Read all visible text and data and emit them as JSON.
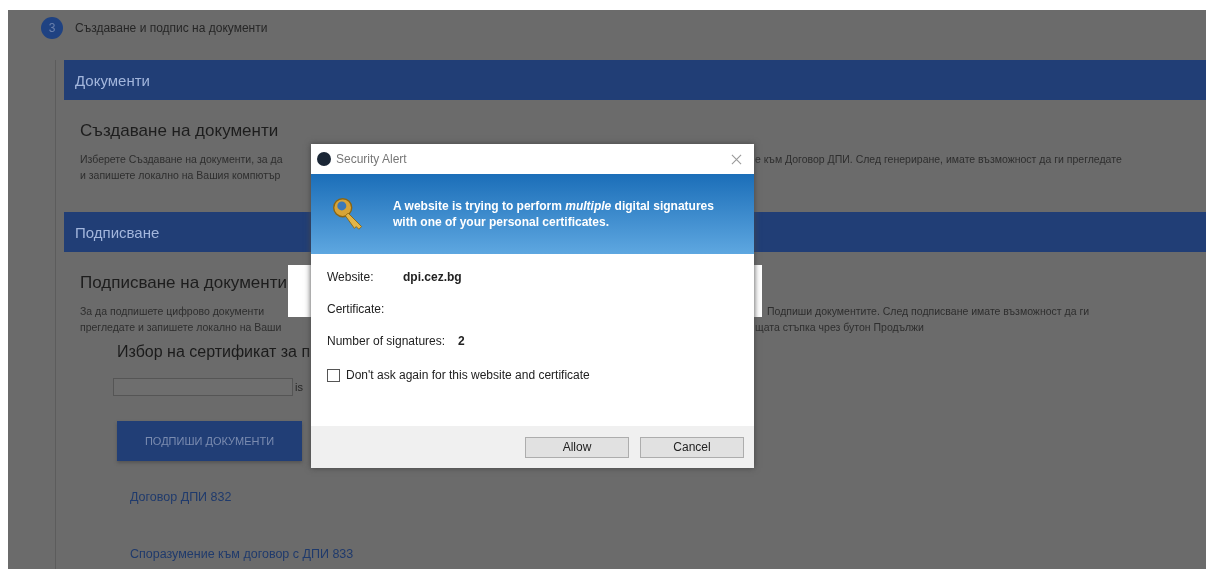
{
  "step": {
    "number": "3",
    "title": "Създаване и подпис на документи"
  },
  "sections": [
    {
      "title": "Документи",
      "heading": "Създаване на документи",
      "text_left": [
        "Изберете Създаване на документи, за да",
        "и запишете локално на Вашия компютър"
      ],
      "text_right": [
        "е към Договор ДПИ. След генериране, имате възможност да ги прегледате"
      ]
    },
    {
      "title": "Подписване",
      "heading": "Подписване на документи",
      "text_left": [
        "За да подпишете цифрово документи",
        "прегледате и запишете локално на Ваши"
      ],
      "text_right": [
        "Подпиши документите. След подписване имате възможност да ги",
        "щата стъпка чрез бутон Продължи"
      ],
      "certificate_label": "Избор на сертификат за п",
      "certificate_fragment": "is",
      "sign_button": "ПОДПИШИ ДОКУМЕНТИ",
      "documents": [
        "Договор ДПИ 832",
        "Споразумение към договор с ДПИ 833"
      ]
    }
  ],
  "dialog": {
    "title": "Security Alert",
    "message": "A website is trying to perform *multiple* digital signatures with one of your personal certificates.",
    "details": [
      {
        "label": "Website:",
        "value": "dpi.cez.bg"
      },
      {
        "label": "Certificate:"
      },
      {
        "label": "Number of signatures:",
        "value": "2"
      }
    ],
    "checkbox": {
      "label": "Don't ask again for this website and certificate",
      "checked": false
    },
    "buttons": [
      "Allow",
      "Cancel"
    ]
  }
}
